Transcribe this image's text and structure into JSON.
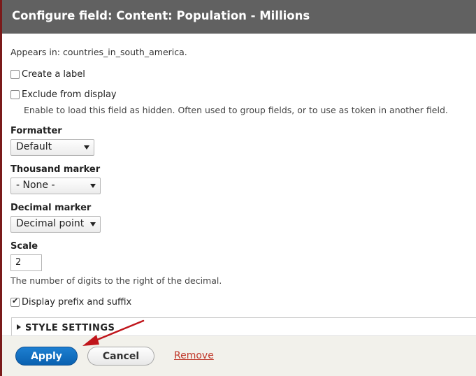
{
  "dialog": {
    "title": "Configure field: Content: Population - Millions",
    "appears_in": "Appears in: countries_in_south_america.",
    "create_label": {
      "label": "Create a label",
      "checked": false
    },
    "exclude": {
      "label": "Exclude from display",
      "checked": false,
      "description": "Enable to load this field as hidden. Often used to group fields, or to use as token in another field."
    },
    "formatter": {
      "label": "Formatter",
      "value": "Default"
    },
    "thousand": {
      "label": "Thousand marker",
      "value": "- None -"
    },
    "decimal": {
      "label": "Decimal marker",
      "value": "Decimal point"
    },
    "scale": {
      "label": "Scale",
      "value": "2",
      "description": "The number of digits to the right of the decimal."
    },
    "prefix_suffix": {
      "label": "Display prefix and suffix",
      "checked": true
    },
    "style_settings": "STYLE SETTINGS"
  },
  "footer": {
    "apply": "Apply",
    "cancel": "Cancel",
    "remove": "Remove"
  },
  "colors": {
    "titlebar": "#616161",
    "apply": "#0a61b0",
    "remove_link": "#c0392b",
    "annotation_arrow": "#c0151b"
  }
}
